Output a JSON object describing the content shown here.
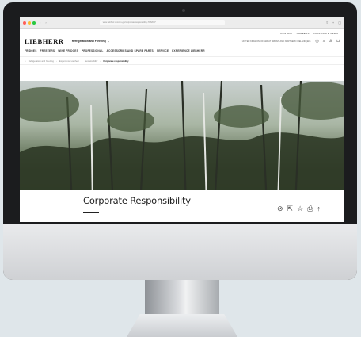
{
  "browser": {
    "url": "www.liebherr.com/en-gbr/corporate-responsibility-7982007"
  },
  "utility_nav": [
    "CONTACT",
    "CAREERS",
    "CORPORATE NEWS"
  ],
  "brand": {
    "logo": "LIEBHERR",
    "division": "Refrigeration and Freezing",
    "location": "UNITED KINGDOM OF GREAT BRITAIN AND NORTHERN IRELAND (EN)"
  },
  "main_nav": [
    "FRIDGES",
    "FREEZERS",
    "WINE FRIDGES",
    "PROFESSIONAL",
    "ACCESSORIES AND SPARE PARTS",
    "SERVICE",
    "EXPERIENCE LIEBHERR"
  ],
  "breadcrumb": [
    "Refrigeration and freezing",
    "Experience Liebherr",
    "Sustainability",
    "Corporate responsibility"
  ],
  "hero": {
    "title": "Corporate Responsibility"
  },
  "colors": {
    "brand_yellow": "#ffd000",
    "text": "#222222",
    "bezel": "#1b1c1e"
  },
  "icons": {
    "header": [
      "globe-icon",
      "search-icon",
      "user-icon",
      "cart-icon"
    ],
    "actions": [
      "compare-icon",
      "share-icon",
      "bookmark-icon",
      "print-icon",
      "scroll-up-icon"
    ]
  }
}
